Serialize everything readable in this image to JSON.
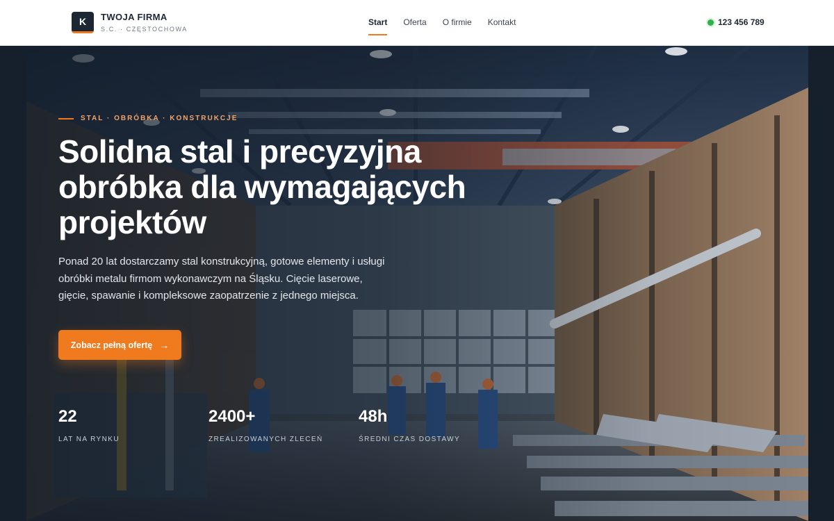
{
  "brand": {
    "mark": "K",
    "name": "TWOJA FIRMA",
    "subtitle": "S.C. · CZĘSTOCHOWA"
  },
  "nav": {
    "items": [
      {
        "label": "Start",
        "active": true
      },
      {
        "label": "Oferta",
        "active": false
      },
      {
        "label": "O firmie",
        "active": false
      },
      {
        "label": "Kontakt",
        "active": false
      }
    ]
  },
  "contact": {
    "phone": "123 456 789",
    "status_color": "#2db34a"
  },
  "hero": {
    "eyebrow": "STAL · OBRÓBKA · KONSTRUKCJE",
    "headline": "Solidna stal i precyzyjna obróbka dla wymagających projektów",
    "lead": "Ponad 20 lat dostarczamy stal konstrukcyjną, gotowe elementy i usługi obróbki metalu firmom wykonawczym na Śląsku. Cięcie laserowe, gięcie, spawanie i kompleksowe zaopatrzenie z jednego miejsca.",
    "cta_label": "Zobacz pełną ofertę",
    "cta_icon": "arrow-right-icon",
    "stats": [
      {
        "value": "22",
        "label": "LAT NA RYNKU"
      },
      {
        "value": "2400+",
        "label": "ZREALIZOWANYCH ZLECEŃ"
      },
      {
        "value": "48h",
        "label": "ŚREDNI CZAS DOSTAWY"
      }
    ]
  },
  "colors": {
    "accent": "#f07a1e",
    "dark": "#1c2733",
    "header_bg": "#ffffff"
  }
}
